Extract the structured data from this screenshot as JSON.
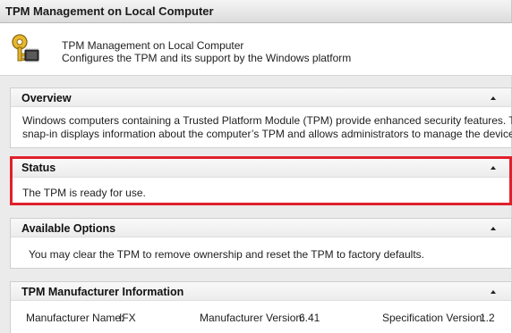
{
  "window": {
    "title": "TPM Management on Local Computer"
  },
  "header": {
    "icon": "tpm-key-chip-icon",
    "line1": "TPM Management on Local Computer",
    "line2": "Configures the TPM and its support by the Windows platform"
  },
  "overview": {
    "title": "Overview",
    "line1": "Windows computers containing a Trusted Platform Module (TPM) provide enhanced security features. This",
    "line2": "snap-in displays information about the computer’s TPM and allows administrators to manage the device."
  },
  "status": {
    "title": "Status",
    "text": "The TPM is ready for use.",
    "highlight_color": "#e0202b"
  },
  "options": {
    "title": "Available Options",
    "text": "You may clear the TPM to remove ownership and reset the TPM to factory defaults."
  },
  "manufacturer": {
    "title": "TPM Manufacturer Information",
    "name_label": "Manufacturer Name:",
    "name_value": "IFX",
    "version_label": "Manufacturer Version:",
    "version_value": "6.41",
    "spec_label": "Specification Version:",
    "spec_value": "1.2"
  },
  "icons": {
    "collapse": "collapse-up-icon"
  }
}
